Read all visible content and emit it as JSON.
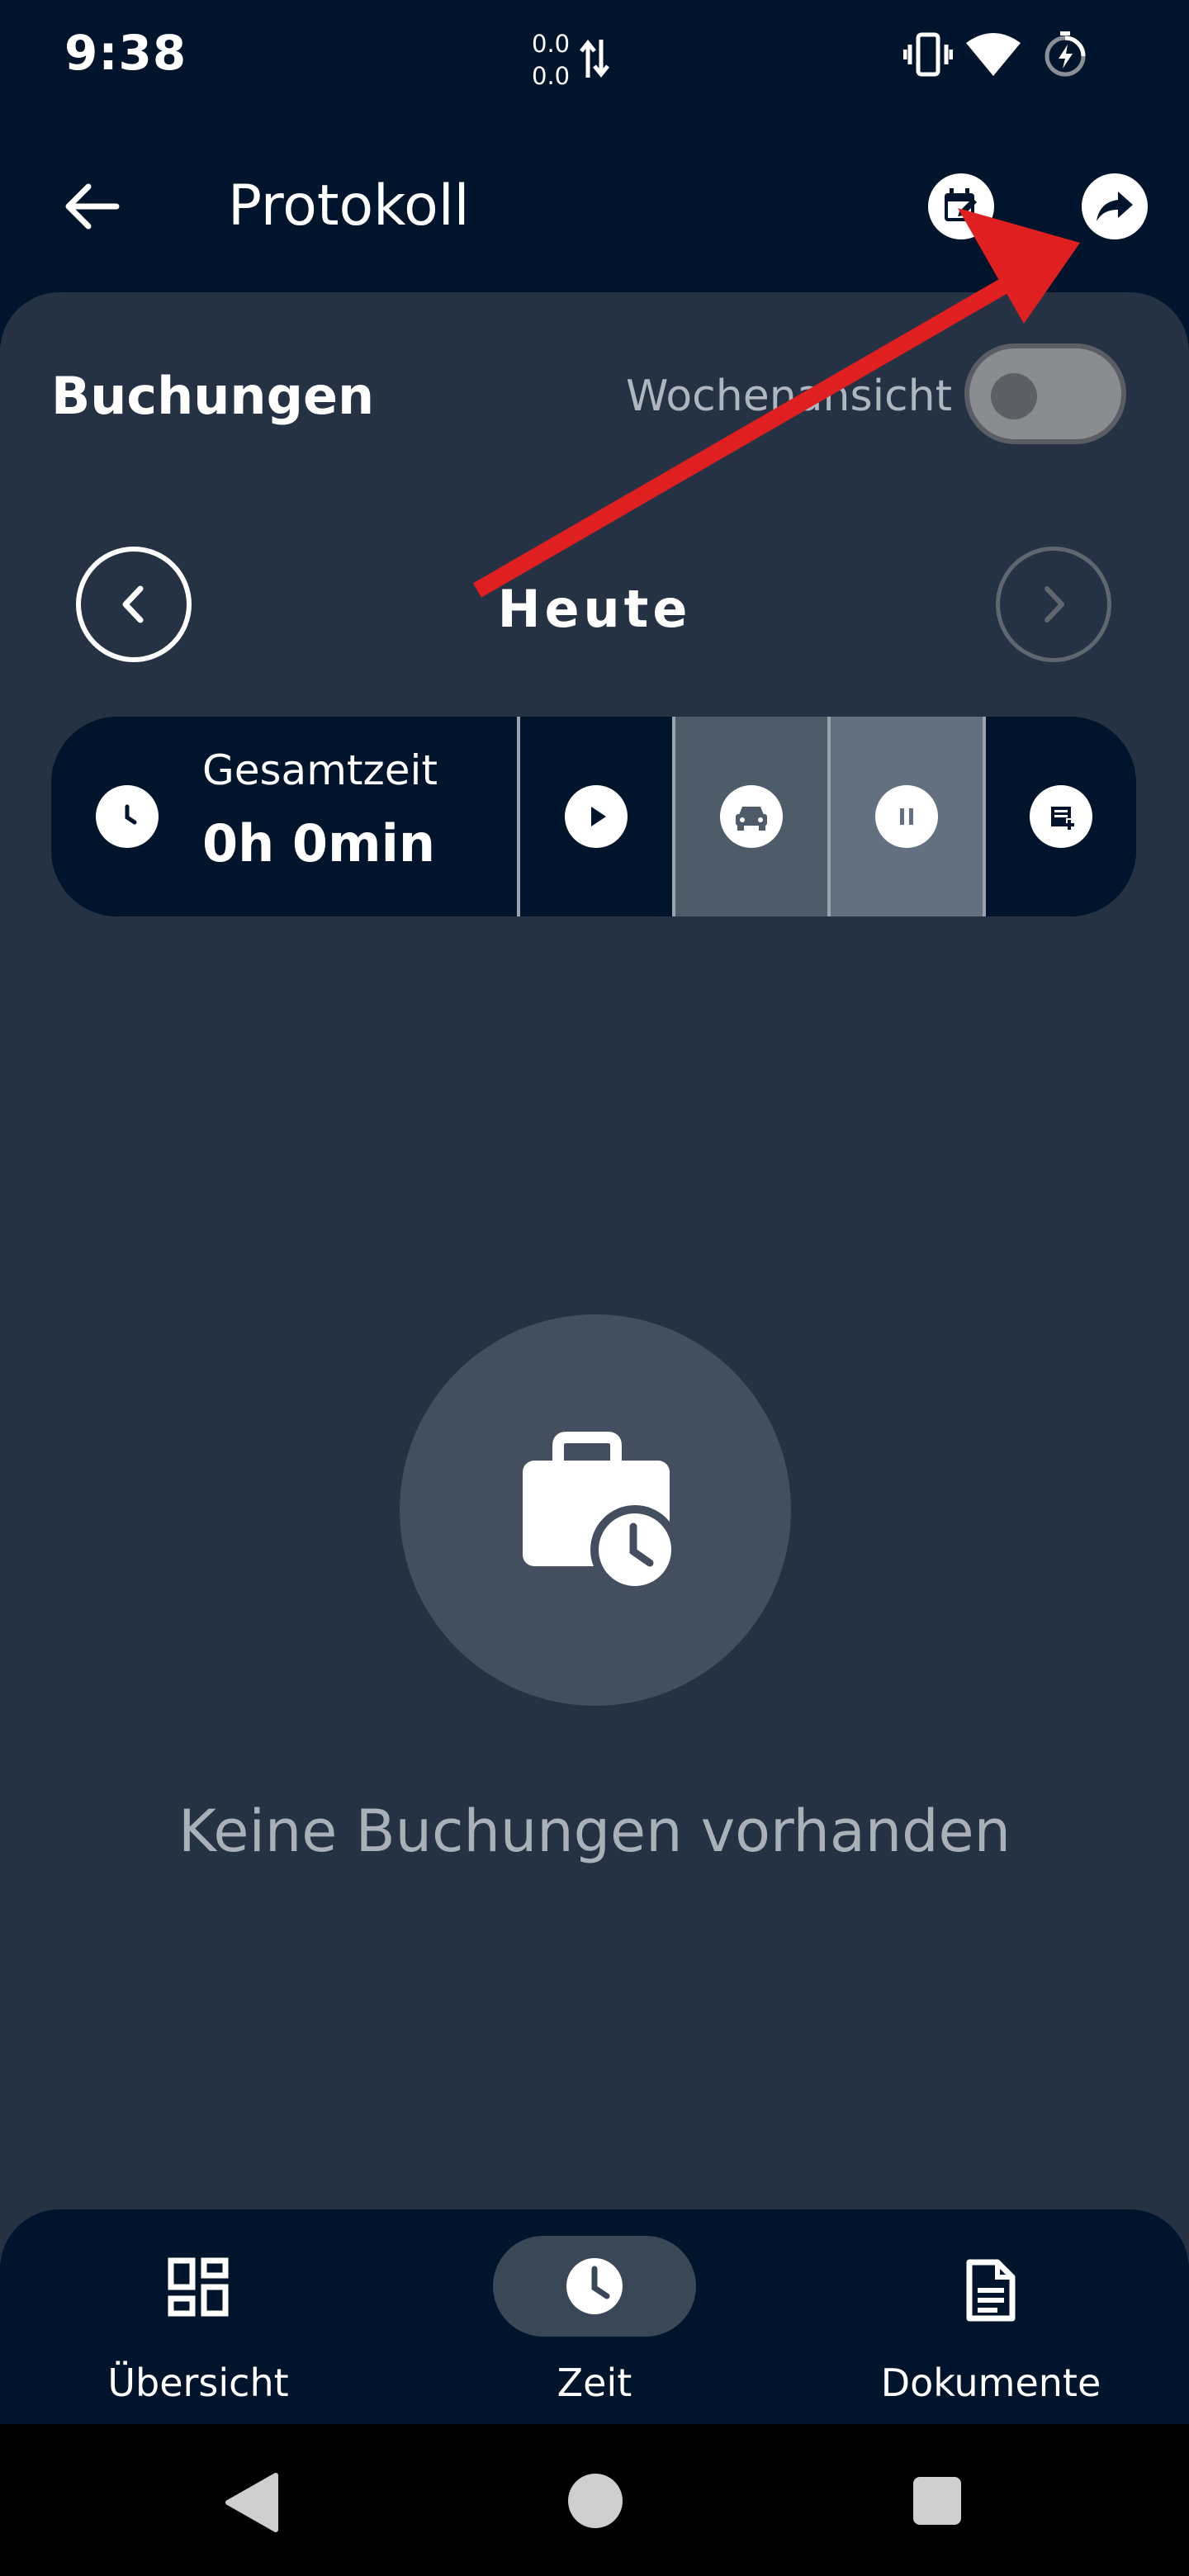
{
  "status_bar": {
    "time": "9:38",
    "net_up": "0.0",
    "net_down": "0.0",
    "icons": [
      "vibrate-icon",
      "wifi-icon",
      "battery-charging-icon"
    ]
  },
  "app_bar": {
    "title": "Protokoll",
    "actions": [
      "edit-calendar-icon",
      "share-forward-icon"
    ]
  },
  "bookings": {
    "section_title": "Buchungen",
    "week_view_label": "Wochenansicht",
    "week_view_on": false,
    "day_label": "Heute",
    "total_label": "Gesamtzeit",
    "total_value": "0h 0min",
    "actions": [
      "play-icon",
      "car-icon",
      "pause-icon",
      "add-note-icon"
    ]
  },
  "empty_state": {
    "icon": "briefcase-clock-icon",
    "text": "Keine Buchungen vorhanden"
  },
  "bottom_nav": {
    "items": [
      {
        "label": "Übersicht",
        "icon": "dashboard-grid-icon",
        "active": false
      },
      {
        "label": "Zeit",
        "icon": "clock-icon",
        "active": true
      },
      {
        "label": "Dokumente",
        "icon": "document-icon",
        "active": false
      }
    ]
  },
  "colors": {
    "background": "#00142b",
    "sheet": "#243244",
    "annotation": "#e02020"
  }
}
